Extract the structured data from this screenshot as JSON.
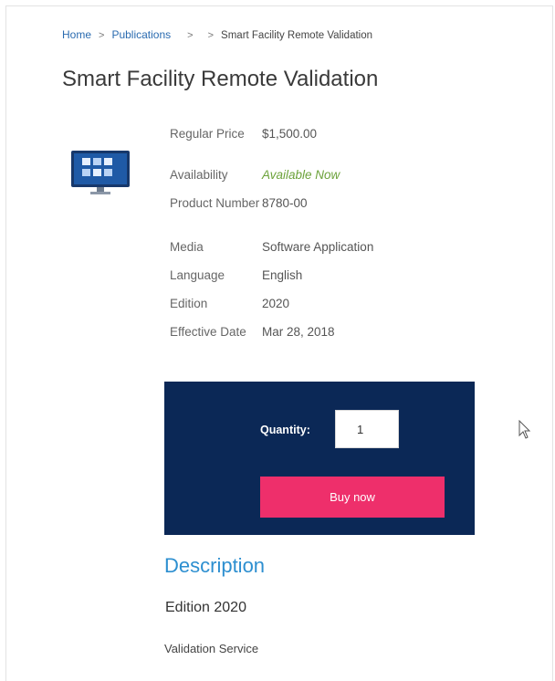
{
  "breadcrumb": {
    "home": "Home",
    "separator": ">",
    "publications": "Publications",
    "current": "Smart Facility Remote Validation"
  },
  "title": "Smart Facility Remote Validation",
  "product_image_icon": "monitor-icon",
  "details": {
    "regular_price_label": "Regular Price",
    "regular_price": "$1,500.00",
    "availability_label": "Availability",
    "availability": "Available Now",
    "product_number_label": "Product Number",
    "product_number": "8780-00",
    "media_label": "Media",
    "media": "Software Application",
    "language_label": "Language",
    "language": "English",
    "edition_label": "Edition",
    "edition": "2020",
    "effective_date_label": "Effective Date",
    "effective_date": "Mar 28, 2018"
  },
  "purchase": {
    "quantity_label": "Quantity:",
    "quantity_value": "1",
    "buy_label": "Buy now"
  },
  "description": {
    "heading": "Description",
    "edition": "Edition 2020",
    "service": "Validation Service"
  },
  "colors": {
    "panel": "#0b2856",
    "buy_button": "#ee2f6b",
    "link": "#2a6bb0",
    "heading_accent": "#2d8fd0",
    "available": "#6ca23a"
  }
}
